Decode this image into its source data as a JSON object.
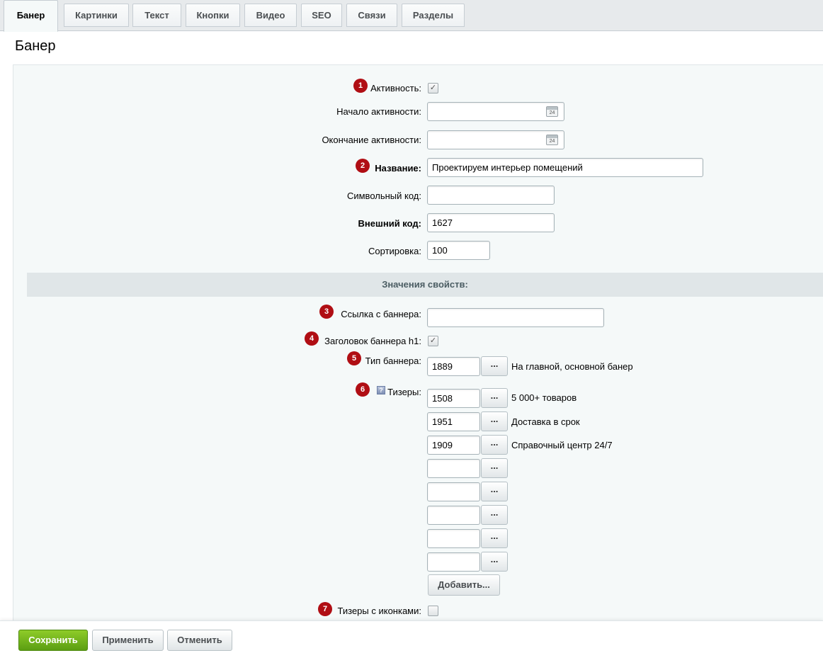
{
  "tabs": [
    {
      "label": "Банер"
    },
    {
      "label": "Картинки"
    },
    {
      "label": "Текст"
    },
    {
      "label": "Кнопки"
    },
    {
      "label": "Видео"
    },
    {
      "label": "SEO"
    },
    {
      "label": "Связи"
    },
    {
      "label": "Разделы"
    }
  ],
  "page_title": "Банер",
  "fields": {
    "active": {
      "badge": "1",
      "label": "Активность:",
      "checked": true
    },
    "active_from": {
      "label": "Начало активности:",
      "value": "",
      "calendar_day": "24"
    },
    "active_to": {
      "label": "Окончание активности:",
      "value": "",
      "calendar_day": "24"
    },
    "name": {
      "badge": "2",
      "label": "Название:",
      "value": "Проектируем интерьер помещений"
    },
    "code": {
      "label": "Символьный код:",
      "value": ""
    },
    "xml_id": {
      "label": "Внешний код:",
      "value": "1627"
    },
    "sort": {
      "label": "Сортировка:",
      "value": "100"
    }
  },
  "section_title": "Значения свойств:",
  "props": {
    "link": {
      "badge": "3",
      "label": "Ссылка с баннера:",
      "value": ""
    },
    "h1": {
      "badge": "4",
      "label": "Заголовок баннера h1:",
      "checked": true
    },
    "type": {
      "badge": "5",
      "label": "Тип баннера:",
      "value": "1889",
      "picker": "...",
      "linked": "На главной, основной банер"
    },
    "teasers": {
      "badge": "6",
      "help": "?",
      "label": "Тизеры:",
      "picker": "...",
      "rows": [
        {
          "value": "1508",
          "linked": "5 000+ товаров"
        },
        {
          "value": "1951",
          "linked": "Доставка в срок"
        },
        {
          "value": "1909",
          "linked": "Справочный центр 24/7"
        },
        {
          "value": "",
          "linked": ""
        },
        {
          "value": "",
          "linked": ""
        },
        {
          "value": "",
          "linked": ""
        },
        {
          "value": "",
          "linked": ""
        },
        {
          "value": "",
          "linked": ""
        }
      ],
      "add_label": "Добавить..."
    },
    "teasers_icons": {
      "badge": "7",
      "label": "Тизеры с иконками:",
      "checked": false
    }
  },
  "footer": {
    "save": "Сохранить",
    "apply": "Применить",
    "cancel": "Отменить"
  },
  "colors": {
    "badge": "#b00e14",
    "save_button": "#6aad17",
    "panel": "#f5f9f9"
  }
}
